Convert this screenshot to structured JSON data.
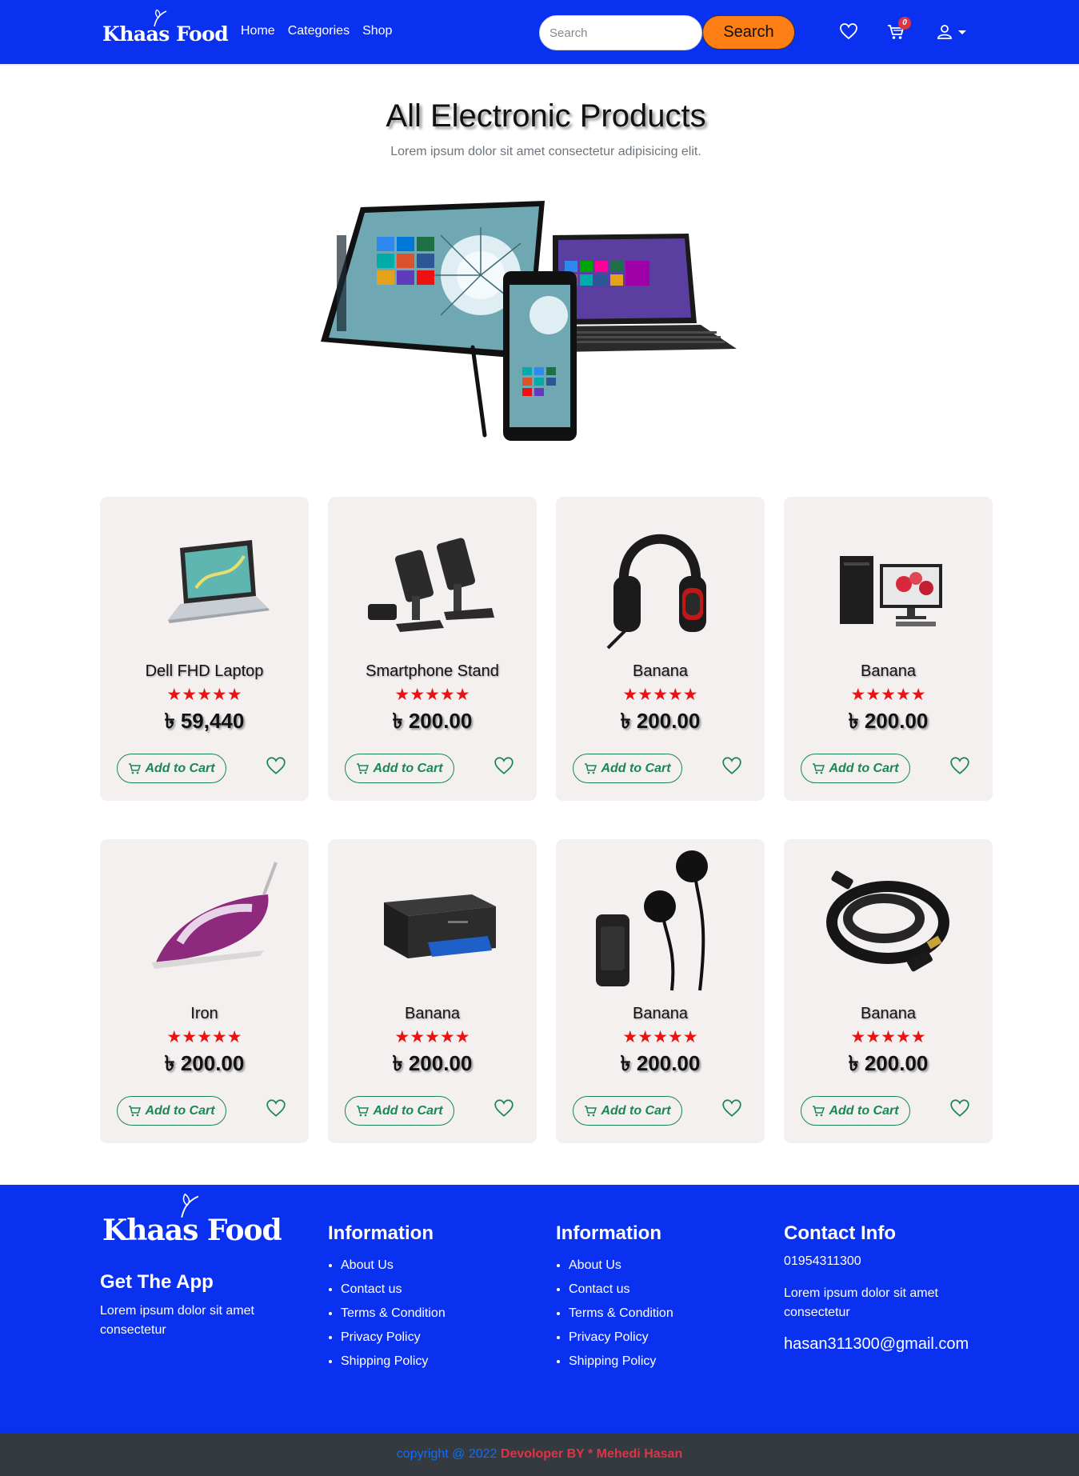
{
  "brand": {
    "name": "Khaas Food"
  },
  "nav": {
    "links": [
      "Home",
      "Categories",
      "Shop"
    ],
    "search_placeholder": "Search",
    "search_button": "Search",
    "cart_count": "0"
  },
  "hero": {
    "title": "All Electronic Products",
    "subtitle": "Lorem ipsum dolor sit amet consectetur adipisicing elit."
  },
  "products": [
    {
      "name": "Dell FHD Laptop",
      "price": "৳ 59,440",
      "rating": 5,
      "image": "laptop"
    },
    {
      "name": "Smartphone Stand",
      "price": "৳ 200.00",
      "rating": 5,
      "image": "phone-stand"
    },
    {
      "name": "Banana",
      "price": "৳ 200.00",
      "rating": 5,
      "image": "headphones"
    },
    {
      "name": "Banana",
      "price": "৳ 200.00",
      "rating": 5,
      "image": "desktop-computer"
    },
    {
      "name": "Iron",
      "price": "৳ 200.00",
      "rating": 5,
      "image": "clothes-iron"
    },
    {
      "name": "Banana",
      "price": "৳ 200.00",
      "rating": 5,
      "image": "printer"
    },
    {
      "name": "Banana",
      "price": "৳ 200.00",
      "rating": 5,
      "image": "earphones"
    },
    {
      "name": "Banana",
      "price": "৳ 200.00",
      "rating": 5,
      "image": "hdmi-cable"
    }
  ],
  "card": {
    "add_to_cart": "Add to Cart",
    "stars": "★★★★★"
  },
  "footer": {
    "app_heading": "Get The App",
    "app_text": "Lorem ipsum dolor sit amet consectetur",
    "info1_heading": "Information",
    "info1_links": [
      "About Us",
      "Contact us",
      "Terms & Condition",
      "Privacy Policy",
      "Shipping Policy"
    ],
    "info2_heading": "Information",
    "info2_links": [
      "About Us",
      "Contact us",
      "Terms & Condition",
      "Privacy Policy",
      "Shipping Policy"
    ],
    "contact_heading": "Contact Info",
    "phone": "01954311300",
    "contact_text": "Lorem ipsum dolor sit amet consectetur",
    "email": "hasan311300@gmail.com"
  },
  "bottom": {
    "copyright": "copyright @ 2022",
    "developer": "Devoloper BY * Mehedi Hasan"
  },
  "colors": {
    "primary_blue": "#0a30f0",
    "search_orange": "#fd7e14",
    "cart_green": "#198754",
    "star_red": "#e81414",
    "card_bg": "#f4f0ef",
    "bottom_bar": "#343a40"
  }
}
